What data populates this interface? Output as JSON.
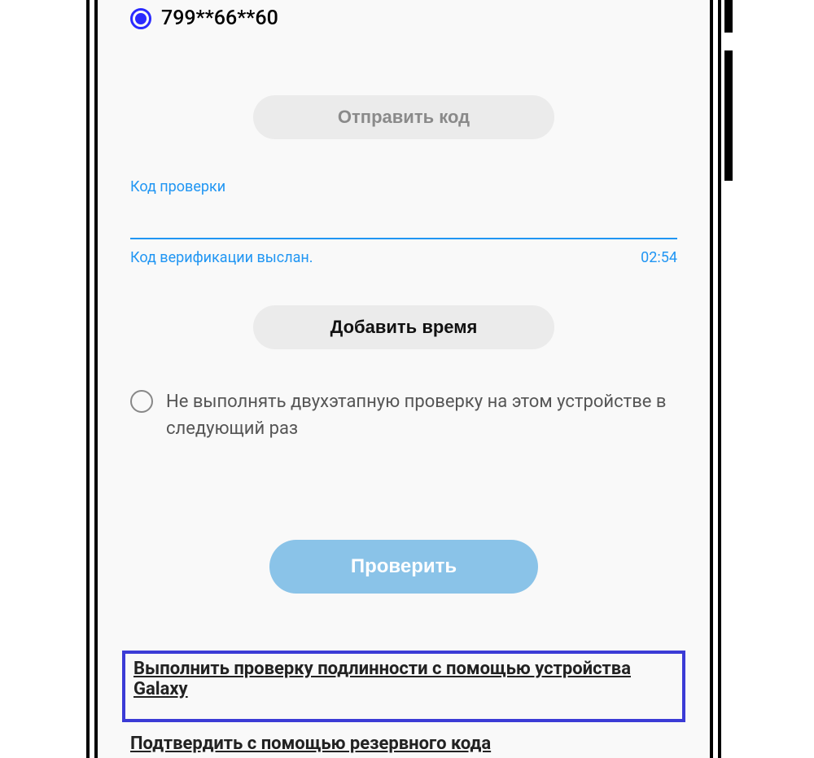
{
  "phone": {
    "masked_number": "799**66**60"
  },
  "buttons": {
    "send_code": "Отправить код",
    "add_time": "Добавить время",
    "verify": "Проверить"
  },
  "input": {
    "label": "Код проверки",
    "value": ""
  },
  "status": {
    "message": "Код верификации выслан.",
    "timer": "02:54"
  },
  "checkbox": {
    "label": "Не выполнять двухэтапную проверку на этом устройстве в следующий раз"
  },
  "links": {
    "galaxy": "Выполнить проверку подлинности с помощью устройства Galaxy",
    "backup": "Подтвердить с помощью резервного кода"
  }
}
